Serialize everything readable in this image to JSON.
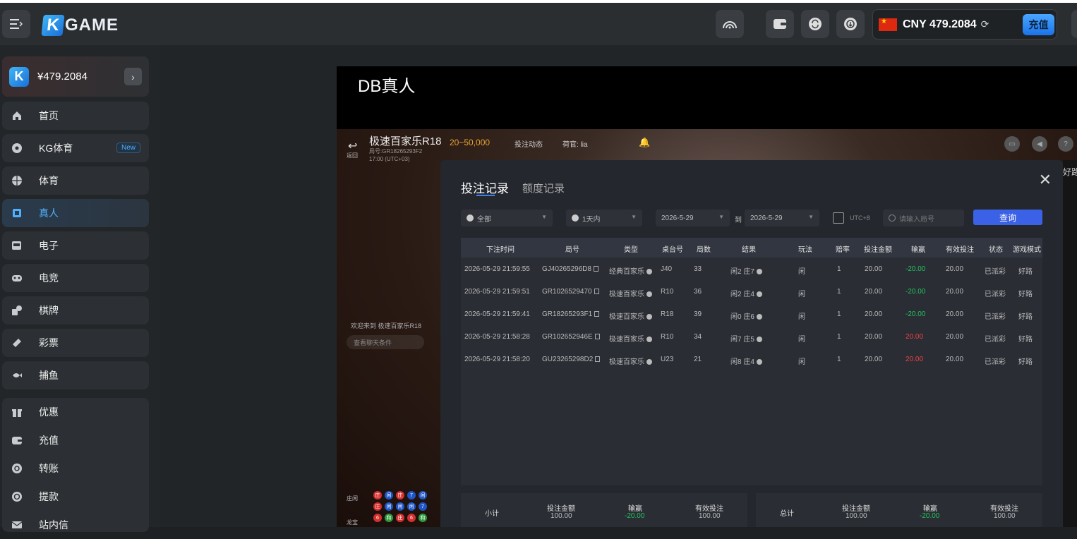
{
  "header": {
    "logo_k": "K",
    "logo_text": "GAME",
    "currency_balance": "CNY 479.2084",
    "deposit_label": "充值"
  },
  "sidebar": {
    "wallet_amount": "¥479.2084",
    "items": [
      {
        "label": "首页",
        "icon": "home-icon"
      },
      {
        "label": "KG体育",
        "icon": "soccer-icon",
        "badge": "New"
      },
      {
        "label": "体育",
        "icon": "basketball-icon"
      },
      {
        "label": "真人",
        "icon": "cards-icon"
      },
      {
        "label": "电子",
        "icon": "slot-icon"
      },
      {
        "label": "电竞",
        "icon": "gamepad-icon"
      },
      {
        "label": "棋牌",
        "icon": "chess-icon"
      },
      {
        "label": "彩票",
        "icon": "lottery-icon"
      },
      {
        "label": "捕鱼",
        "icon": "fish-icon"
      }
    ],
    "extra_items": [
      {
        "label": "优惠",
        "icon": "gift-icon"
      },
      {
        "label": "充值",
        "icon": "wallet-icon"
      },
      {
        "label": "转账",
        "icon": "transfer-icon"
      },
      {
        "label": "提款",
        "icon": "withdraw-icon"
      },
      {
        "label": "站内信",
        "icon": "mail-icon"
      }
    ]
  },
  "game": {
    "title": "DB真人",
    "back_label": "返回",
    "table_name": "极速百家乐R18",
    "table_id": "局号:GR18265293F2",
    "table_time": "17:00 (UTC+03)",
    "limits": "20~50,000",
    "bet_dynamic": "投注动态",
    "dealer": "荷官: lia",
    "welcome": "欢迎来到 极速百家乐R18",
    "history_bar": "查看聊天条件",
    "road_label_1": "庄闲",
    "road_label_2": "龙宝",
    "right_partial": "好路"
  },
  "modal": {
    "tab_active": "投注记录",
    "tab_inactive": "额度记录",
    "filter_type": "全部",
    "filter_range": "1天内",
    "date_from": "2026-5-29",
    "to_label": "到",
    "date_to": "2026-5-29",
    "timezone": "UTC+8",
    "round_placeholder": "请输入局号",
    "query_label": "查询",
    "columns": [
      "下注时间",
      "局号",
      "类型",
      "桌台号",
      "局数",
      "结果",
      "玩法",
      "赔率",
      "投注金额",
      "输赢",
      "有效投注",
      "状态",
      "游戏模式"
    ],
    "rows": [
      [
        "2026-05-29 21:59:55",
        "GJ40265296D8",
        "经典百家乐",
        "J40",
        "33",
        "闲2 庄7",
        "闲",
        "1",
        "20.00",
        "-20.00",
        "20.00",
        "已派彩",
        "好路"
      ],
      [
        "2026-05-29 21:59:51",
        "GR1026529470",
        "极速百家乐",
        "R10",
        "36",
        "闲2 庄4",
        "闲",
        "1",
        "20.00",
        "-20.00",
        "20.00",
        "已派彩",
        "好路"
      ],
      [
        "2026-05-29 21:59:41",
        "GR18265293F1",
        "极速百家乐",
        "R18",
        "39",
        "闲0 庄6",
        "闲",
        "1",
        "20.00",
        "-20.00",
        "20.00",
        "已派彩",
        "好路"
      ],
      [
        "2026-05-29 21:58:28",
        "GR102652946E",
        "极速百家乐",
        "R10",
        "34",
        "闲7 庄5",
        "闲",
        "1",
        "20.00",
        "20.00",
        "20.00",
        "已派彩",
        "好路"
      ],
      [
        "2026-05-29 21:58:20",
        "GU23265298D2",
        "极速百家乐",
        "U23",
        "21",
        "闲8 庄4",
        "闲",
        "1",
        "20.00",
        "20.00",
        "20.00",
        "已派彩",
        "好路"
      ]
    ],
    "subtotal": {
      "label": "小计",
      "bet_h": "投注金额",
      "bet": "100.00",
      "win_h": "输赢",
      "win": "-20.00",
      "valid_h": "有效投注",
      "valid": "100.00"
    },
    "total": {
      "label": "总计",
      "bet_h": "投注金额",
      "bet": "100.00",
      "win_h": "输赢",
      "win": "-20.00",
      "valid_h": "有效投注",
      "valid": "100.00"
    }
  },
  "colors": {
    "accent": "#3b62e6",
    "win": "#22c55e",
    "loss": "#ef4444",
    "limits": "#e8a330"
  }
}
